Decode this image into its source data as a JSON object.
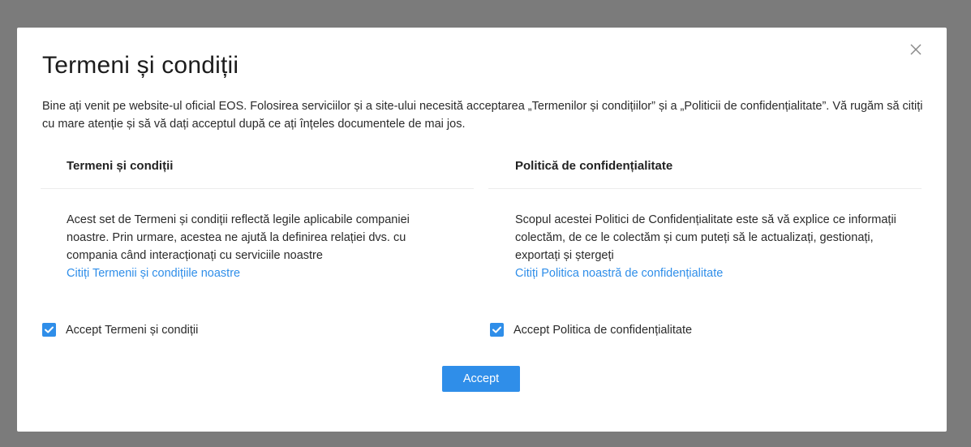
{
  "modal": {
    "title": "Termeni și condiții",
    "close_icon": "close-icon",
    "intro": "Bine ați venit pe website-ul oficial EOS. Folosirea serviciilor și a site-ului necesită acceptarea „Termenilor și condițiilor” și a „Politicii de confidențialitate”. Vă rugăm să citiți cu mare atenție și să vă dați acceptul după ce ați înțeles documentele de mai jos.",
    "terms": {
      "heading": "Termeni și condiții",
      "body": "Acest set de Termeni și condiții reflectă legile aplicabile companiei noastre. Prin urmare, acestea ne ajută la definirea relației dvs. cu compania când interacționați cu serviciile noastre",
      "link": "Citiți Termenii și condițiile noastre",
      "checkbox_label": "Accept Termeni și condiții",
      "checked": true
    },
    "privacy": {
      "heading": "Politică de confidențialitate",
      "body": "Scopul acestei Politici de Confidențialitate este să vă explice ce informații colectăm, de ce le colectăm și cum puteți să le actualizați, gestionați, exportați și ștergeți",
      "link": "Citiți Politica noastră de confidențialitate",
      "checkbox_label": "Accept Politica de confidențialitate",
      "checked": true
    },
    "accept_button": "Accept"
  },
  "colors": {
    "accent": "#2f8ee9",
    "overlay": "#7b7b7b",
    "text": "#2a2a2a"
  }
}
